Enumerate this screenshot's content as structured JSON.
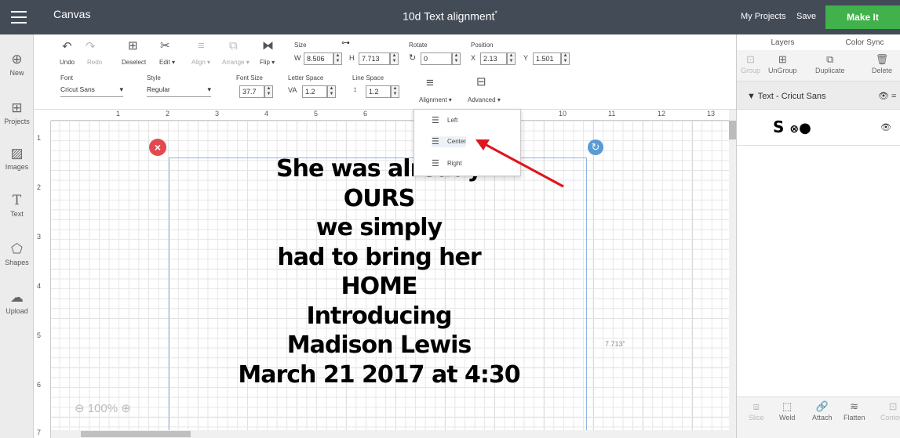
{
  "app": {
    "title": "Canvas",
    "doc_title": "10d Text alignment",
    "unsaved_mark": "*",
    "my_projects": "My Projects",
    "save": "Save",
    "make_it": "Make It"
  },
  "leftbar": {
    "new": "New",
    "projects": "Projects",
    "images": "Images",
    "text": "Text",
    "shapes": "Shapes",
    "upload": "Upload"
  },
  "toolbar": {
    "undo": "Undo",
    "redo": "Redo",
    "deselect": "Deselect",
    "edit": "Edit",
    "align": "Align",
    "arrange": "Arrange",
    "flip": "Flip",
    "size_label": "Size",
    "w_label": "W",
    "w_value": "8.506",
    "h_label": "H",
    "h_value": "7.713",
    "rotate_label": "Rotate",
    "rotate_value": "0",
    "position_label": "Position",
    "x_label": "X",
    "x_value": "2.13",
    "y_label": "Y",
    "y_value": "1.501",
    "font_label": "Font",
    "font_value": "Cricut Sans",
    "style_label": "Style",
    "style_value": "Regular",
    "fontsize_label": "Font Size",
    "fontsize_value": "37.7",
    "letterspace_label": "Letter Space",
    "letterspace_value": "1.2",
    "linespace_label": "Line Space",
    "linespace_value": "1.2",
    "alignment": "Alignment",
    "advanced": "Advanced"
  },
  "ruler": {
    "top": [
      "1",
      "2",
      "3",
      "4",
      "5",
      "6",
      "7",
      "8",
      "9",
      "10",
      "11",
      "12",
      "13"
    ],
    "left": [
      "1",
      "2",
      "3",
      "4",
      "5",
      "6",
      "7"
    ]
  },
  "canvas": {
    "lines": [
      "She was already",
      "OURS",
      "we simply",
      "had to bring her",
      "HOME",
      "Introducing",
      "Madison Lewis",
      "March 21 2017 at 4:30"
    ],
    "dimension": "7.713\"",
    "zoom": "100%"
  },
  "alignment_menu": {
    "left": "Left",
    "center": "Center",
    "right": "Right"
  },
  "rightpanel": {
    "tab_layers": "Layers",
    "tab_color_sync": "Color Sync",
    "group": "Group",
    "ungroup": "UnGroup",
    "duplicate": "Duplicate",
    "delete": "Delete",
    "layer_group_name": "Text - Cricut Sans",
    "layer_preview": "S",
    "slice": "Slice",
    "weld": "Weld",
    "attach": "Attach",
    "flatten": "Flatten",
    "contour": "Contour"
  },
  "colors": {
    "topbar": "#434b57",
    "make_it": "#41b14b",
    "arrow": "#e0141b",
    "delete_handle": "#e24a4f",
    "rotate_handle": "#5b9bd5"
  }
}
